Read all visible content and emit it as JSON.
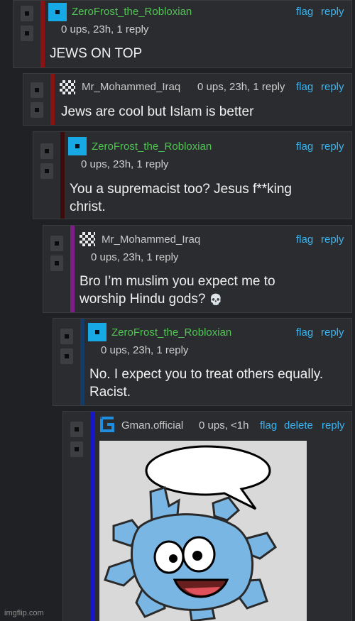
{
  "comments": [
    {
      "user": "ZeroFrost_the_Robloxian",
      "meta": "0 ups, 23h, 1 reply",
      "flag": "flag",
      "reply": "reply",
      "body": [
        "JEWS ON TOP"
      ]
    },
    {
      "user": "Mr_Mohammed_Iraq",
      "meta": "0 ups, 23h, 1 reply",
      "flag": "flag",
      "reply": "reply",
      "body": [
        "Jews are cool but Islam is better"
      ]
    },
    {
      "user": "ZeroFrost_the_Robloxian",
      "meta": "0 ups, 23h, 1 reply",
      "flag": "flag",
      "reply": "reply",
      "body": [
        "You a supremacist too? Jesus f**king",
        "christ."
      ]
    },
    {
      "user": "Mr_Mohammed_Iraq",
      "meta": "0 ups, 23h, 1 reply",
      "flag": "flag",
      "reply": "reply",
      "body": [
        "Bro I’m muslim you expect me to",
        "worship Hindu gods?"
      ],
      "emoji": "💀"
    },
    {
      "user": "ZeroFrost_the_Robloxian",
      "meta": "0 ups, 23h, 1 reply",
      "flag": "flag",
      "reply": "reply",
      "body": [
        "No. I expect you to treat others equally.",
        "Racist."
      ]
    },
    {
      "user": "Gman.official",
      "meta": "0 ups, <1h",
      "flag": "flag",
      "delete": "delete",
      "reply": "reply"
    }
  ],
  "colors": {
    "bar_red": "#8b1212",
    "bar_dark_red": "#3d0c0c",
    "bar_purple": "#7d1f87",
    "bar_navy": "#163a66",
    "bar_blue": "#1717c9",
    "link": "#39b4f0",
    "username_green": "#4fc552"
  },
  "watermark": "imgflip.com"
}
